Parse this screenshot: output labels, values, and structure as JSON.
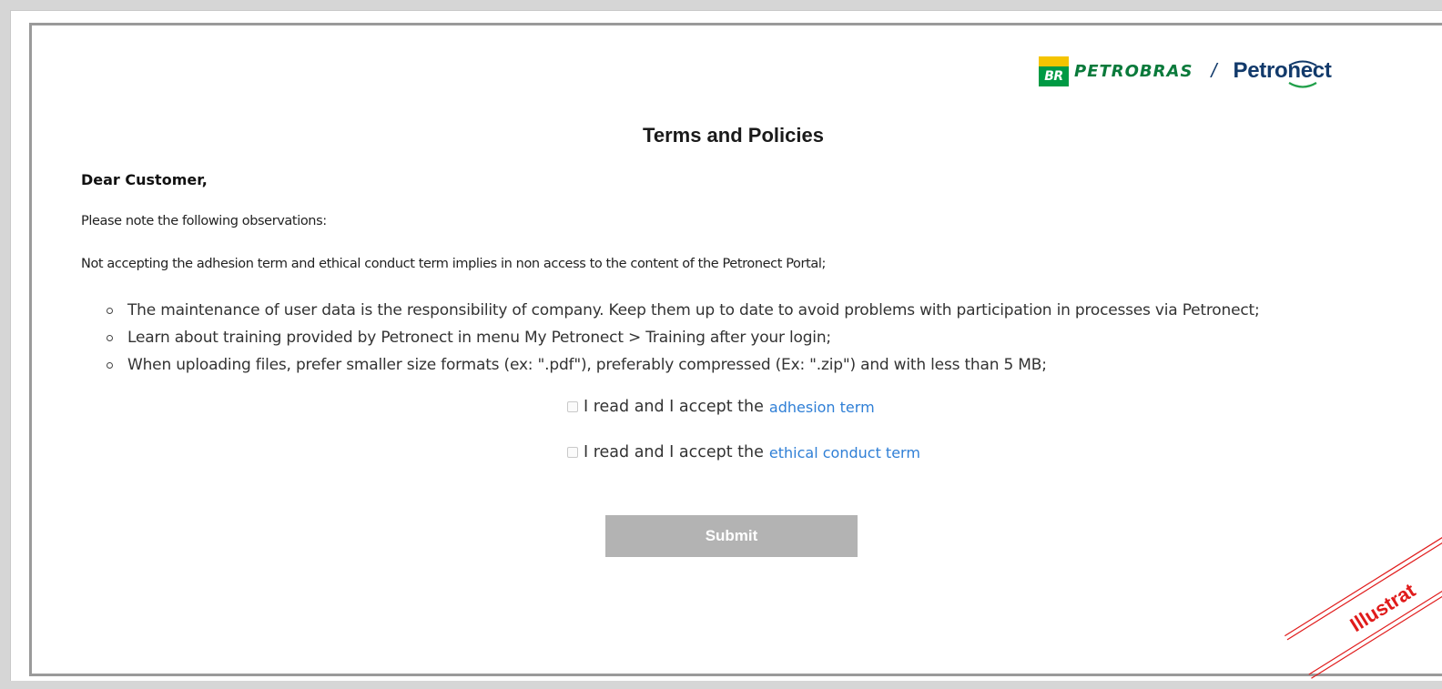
{
  "header": {
    "br_badge": "BR",
    "brand_primary": "PETROBRAS",
    "separator": "/",
    "brand_secondary": "Petronect"
  },
  "page": {
    "title": "Terms and Policies",
    "greeting": "Dear Customer,",
    "note_intro": "Please note the following observations:",
    "note_warning": "Not accepting the adhesion term and ethical conduct term implies in non access to the content of the Petronect Portal;"
  },
  "bullets": [
    "The maintenance of user data is the responsibility of company. Keep them up to date to avoid problems with participation in processes via Petronect;",
    "Learn about training provided by Petronect in menu My Petronect > Training after your login;",
    "When uploading files, prefer smaller size formats (ex: \".pdf\"), preferably compressed (Ex: \".zip\") and with less than 5 MB;"
  ],
  "consents": [
    {
      "prefix": "I read and I accept the",
      "link": "adhesion term",
      "checked": false
    },
    {
      "prefix": "I read and I accept the",
      "link": "ethical conduct term",
      "checked": false
    }
  ],
  "actions": {
    "submit_label": "Submit"
  },
  "watermark": {
    "text": "Illustrat"
  },
  "colors": {
    "link": "#2f7fd6",
    "submit_disabled": "#b3b3b3",
    "petrobras_green": "#0a7a3b",
    "petronect_blue": "#123a6b",
    "watermark_red": "#e01b1b"
  }
}
